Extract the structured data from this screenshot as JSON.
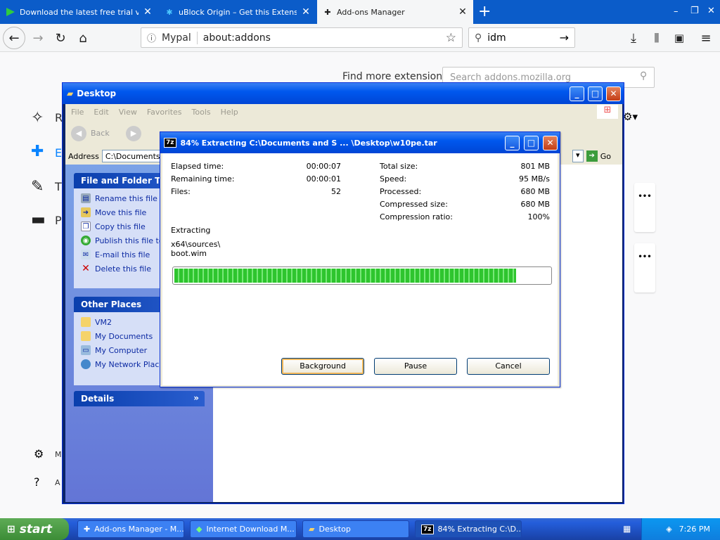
{
  "browser": {
    "tabs": [
      {
        "label": "Download the latest free trial version",
        "icon": "idm-arrow-icon"
      },
      {
        "label": "uBlock Origin – Get this Extension",
        "icon": "ublock-icon"
      },
      {
        "label": "Add-ons Manager",
        "icon": "puzzle-icon"
      }
    ],
    "new_tab": "+",
    "window_controls": {
      "minimize": "–",
      "restore": "❐",
      "close": "✕"
    },
    "url_identity": "Mypal",
    "url": "about:addons",
    "search_value": "idm"
  },
  "addons": {
    "find_more": "Find more extensions",
    "search_placeholder": "Search addons.mozilla.org",
    "categories": [
      {
        "label": "R",
        "icon": "recommendations-icon"
      },
      {
        "label": "E",
        "icon": "extensions-icon"
      },
      {
        "label": "T",
        "icon": "themes-icon"
      },
      {
        "label": "P",
        "icon": "plugins-icon"
      }
    ],
    "footer_items": [
      {
        "label": "M",
        "icon": "gear-icon"
      },
      {
        "label": "A",
        "icon": "help-icon"
      }
    ],
    "card_menu": "•••"
  },
  "explorer": {
    "title": "Desktop",
    "menu": [
      "File",
      "Edit",
      "View",
      "Favorites",
      "Tools",
      "Help"
    ],
    "toolbar": {
      "back": "Back"
    },
    "address_label": "Address",
    "address_value": "C:\\Documents",
    "go_label": "Go",
    "file_tasks_title": "File and Folder Tasks",
    "file_tasks": [
      "Rename this file",
      "Move this file",
      "Copy this file",
      "Publish this file to",
      "E-mail this file",
      "Delete this file"
    ],
    "other_places_title": "Other Places",
    "other_places": [
      "VM2",
      "My Documents",
      "My Computer",
      "My Network Place"
    ],
    "details_title": "Details"
  },
  "dialog": {
    "title": "84% Extracting C:\\Documents and S ... \\Desktop\\w10pe.tar",
    "elapsed_label": "Elapsed time:",
    "elapsed": "00:00:07",
    "remaining_label": "Remaining time:",
    "remaining": "00:00:01",
    "files_label": "Files:",
    "files": "52",
    "total_label": "Total size:",
    "total": "801 MB",
    "speed_label": "Speed:",
    "speed": "95 MB/s",
    "processed_label": "Processed:",
    "processed": "680 MB",
    "compressed_label": "Compressed size:",
    "compressed": "680 MB",
    "ratio_label": "Compression ratio:",
    "ratio": "100%",
    "status": "Extracting",
    "path_line1": "x64\\sources\\",
    "path_line2": "boot.wim",
    "progress_fraction": 0.91,
    "buttons": {
      "background": "Background",
      "pause": "Pause",
      "cancel": "Cancel"
    }
  },
  "taskbar": {
    "start": "start",
    "items": [
      "Add-ons Manager - M...",
      "Internet Download M...",
      "Desktop",
      "84% Extracting C:\\D..."
    ],
    "clock": "7:26 PM"
  }
}
